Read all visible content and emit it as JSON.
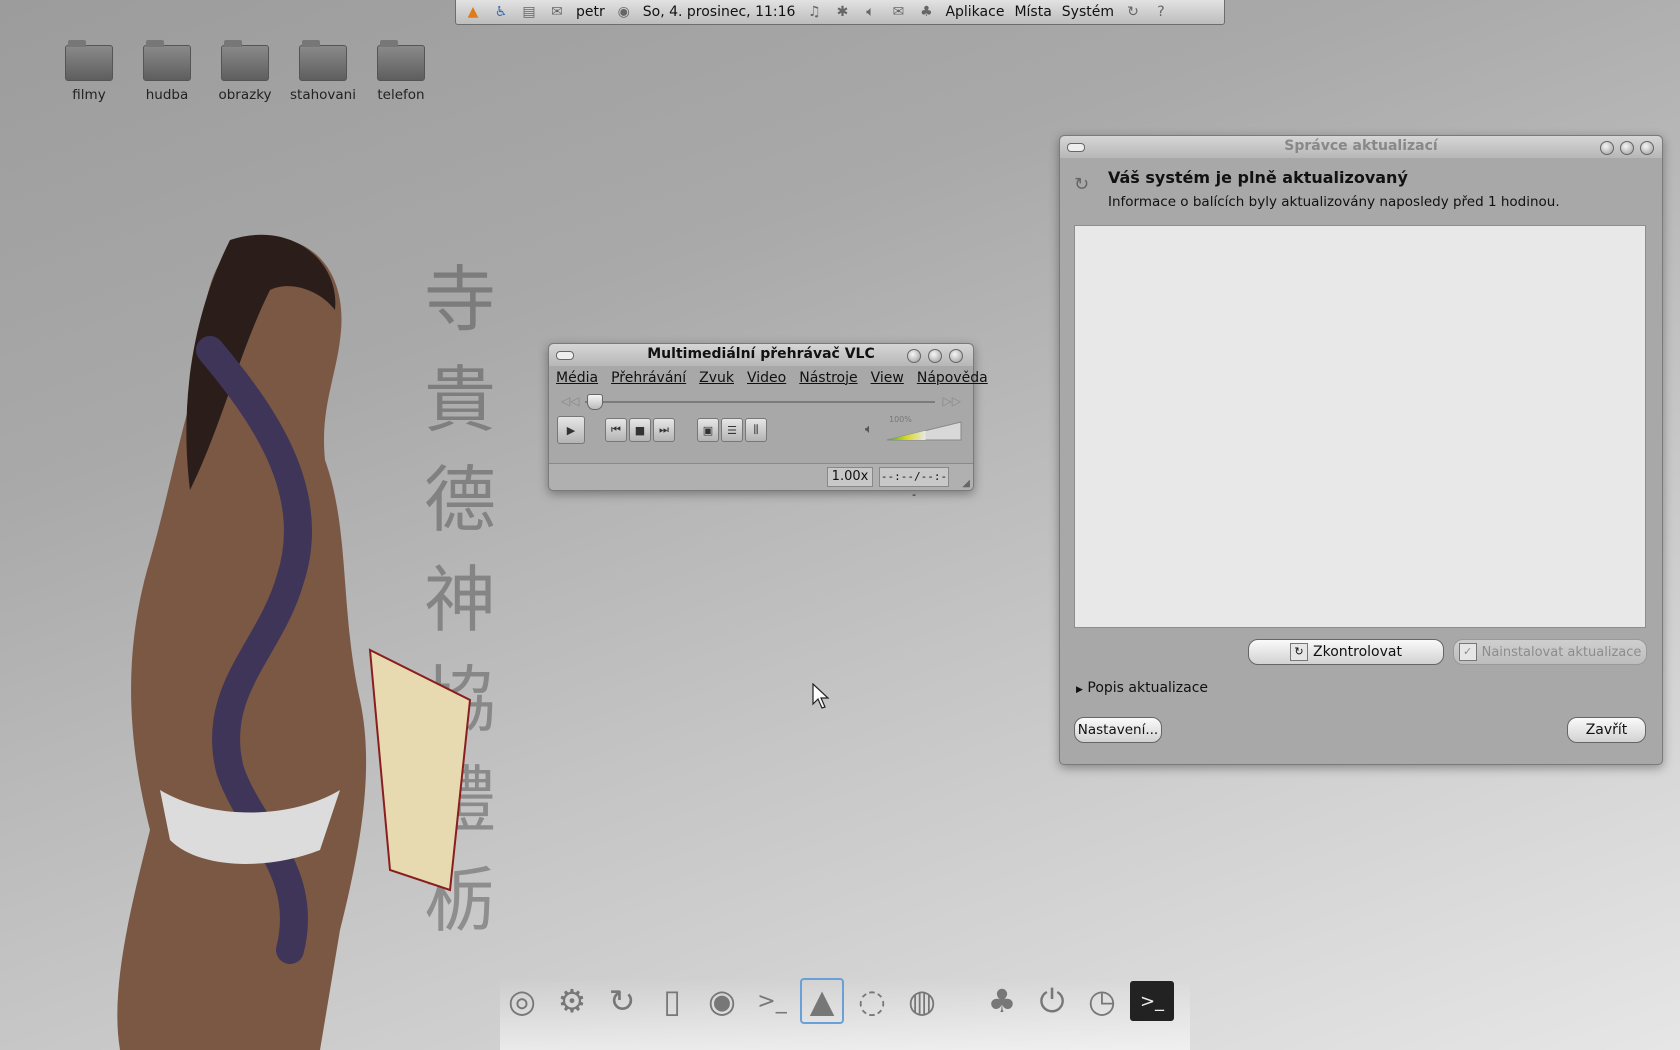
{
  "top_panel": {
    "user": "petr",
    "datetime": "So, 4. prosinec, 11:16",
    "menu_applications": "Aplikace",
    "menu_places": "Místa",
    "menu_system": "Systém"
  },
  "desktop_icons": [
    {
      "label": "filmy"
    },
    {
      "label": "hudba"
    },
    {
      "label": "obrazky"
    },
    {
      "label": "stahovani"
    },
    {
      "label": "telefon"
    }
  ],
  "vlc": {
    "title": "Multimediální přehrávač VLC",
    "menu": [
      "Média",
      "Přehrávání",
      "Zvuk",
      "Video",
      "Nástroje",
      "View",
      "Nápověda"
    ],
    "volume_label": "100%",
    "volume_level": 1.0,
    "speed": "1.00x",
    "time": "--:--/--:--"
  },
  "update_manager": {
    "title": "Správce aktualizací",
    "heading": "Váš systém je plně aktualizovaný",
    "subtext": "Informace o balících byly aktualizovány naposledy před 1 hodinou.",
    "check_button": "Zkontrolovat",
    "install_button": "Nainstalovat aktualizace",
    "description_expander": "Popis aktualizace",
    "settings_button": "Nastavení...",
    "close_button": "Zavřít"
  },
  "colors": {
    "desktop": "#b3b3b3",
    "window_bg": "#a8a8a8",
    "list_bg": "#e8e8e8",
    "dock_active": "#6aa0d8"
  },
  "dock_icons": [
    "swirl-icon",
    "gear-icon",
    "refresh-icon",
    "book-icon",
    "disc-icon",
    "terminal-icon",
    "vlc-icon",
    "swirl2-icon",
    "firefox-icon",
    "gnome-foot-icon",
    "power-icon",
    "clock-icon",
    "console-icon"
  ]
}
